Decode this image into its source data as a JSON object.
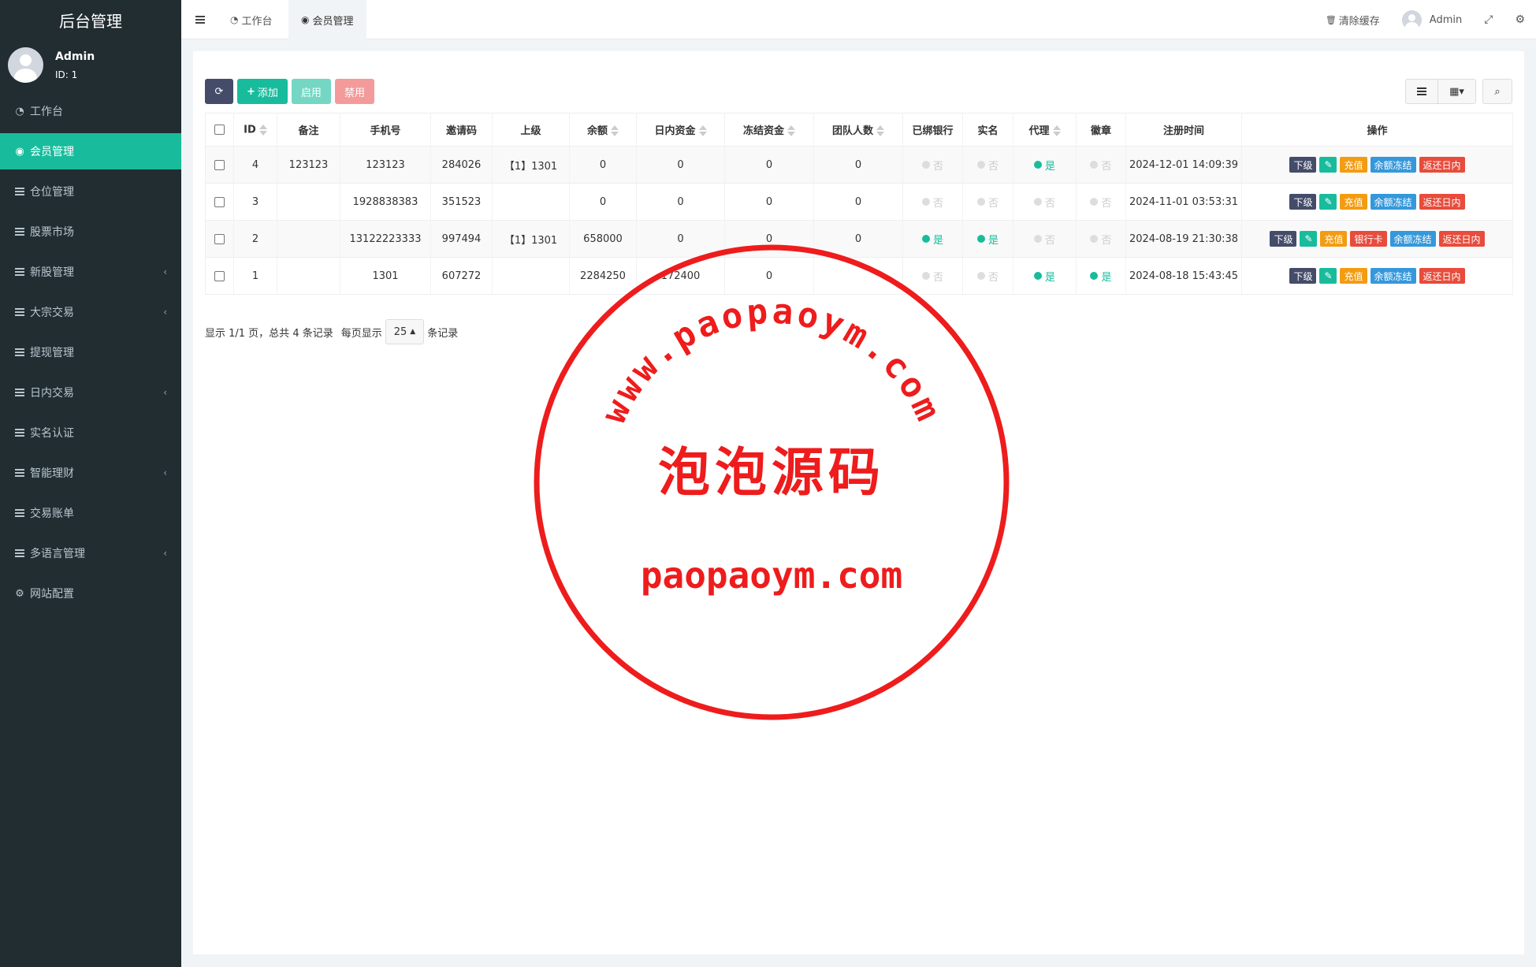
{
  "app": {
    "brand": "后台管理"
  },
  "user": {
    "name": "Admin",
    "id_text": "ID: 1"
  },
  "sidebar": {
    "items": [
      {
        "label": "工作台",
        "icon": "dashboard-icon",
        "glyph": "◔",
        "active": false,
        "expandable": false
      },
      {
        "label": "会员管理",
        "icon": "user-circle-icon",
        "glyph": "◉",
        "active": true,
        "expandable": false
      },
      {
        "label": "仓位管理",
        "icon": "list-icon",
        "glyph": "",
        "active": false,
        "expandable": false
      },
      {
        "label": "股票市场",
        "icon": "list-icon",
        "glyph": "",
        "active": false,
        "expandable": false
      },
      {
        "label": "新股管理",
        "icon": "list-icon",
        "glyph": "",
        "active": false,
        "expandable": true
      },
      {
        "label": "大宗交易",
        "icon": "list-icon",
        "glyph": "",
        "active": false,
        "expandable": true
      },
      {
        "label": "提现管理",
        "icon": "list-icon",
        "glyph": "",
        "active": false,
        "expandable": false
      },
      {
        "label": "日内交易",
        "icon": "list-icon",
        "glyph": "",
        "active": false,
        "expandable": true
      },
      {
        "label": "实名认证",
        "icon": "list-icon",
        "glyph": "",
        "active": false,
        "expandable": false
      },
      {
        "label": "智能理财",
        "icon": "list-icon",
        "glyph": "",
        "active": false,
        "expandable": true
      },
      {
        "label": "交易账单",
        "icon": "list-icon",
        "glyph": "",
        "active": false,
        "expandable": false
      },
      {
        "label": "多语言管理",
        "icon": "list-icon",
        "glyph": "",
        "active": false,
        "expandable": true
      },
      {
        "label": "网站配置",
        "icon": "gear-icon",
        "glyph": "⚙",
        "active": false,
        "expandable": false
      }
    ]
  },
  "topbar": {
    "tabs": [
      {
        "label": "工作台",
        "icon": "dashboard-icon"
      },
      {
        "label": "会员管理",
        "icon": "user-circle-icon"
      }
    ],
    "clear_cache": "清除缓存",
    "user_name": "Admin"
  },
  "toolbar": {
    "add_label": "添加",
    "enable_label": "启用",
    "disable_label": "禁用"
  },
  "table": {
    "headers": [
      "ID",
      "备注",
      "手机号",
      "邀请码",
      "上级",
      "余额",
      "日内资金",
      "冻结资金",
      "团队人数",
      "已绑银行",
      "实名",
      "代理",
      "徽章",
      "注册时间",
      "操作"
    ],
    "yes_text": "是",
    "no_text": "否",
    "rows": [
      {
        "id": "4",
        "remark": "123123",
        "phone": "123123",
        "invite": "284026",
        "parent": "【1】1301",
        "balance": "0",
        "intraday": "0",
        "frozen": "0",
        "team": "0",
        "bank": false,
        "realname": false,
        "agent": true,
        "badge": false,
        "reg_time": "2024-12-01 14:09:39",
        "ops": [
          "下级",
          "edit",
          "充值",
          "余额冻结",
          "返还日内"
        ]
      },
      {
        "id": "3",
        "remark": "",
        "phone": "1928838383",
        "invite": "351523",
        "parent": "",
        "balance": "0",
        "intraday": "0",
        "frozen": "0",
        "team": "0",
        "bank": false,
        "realname": false,
        "agent": false,
        "badge": false,
        "reg_time": "2024-11-01 03:53:31",
        "ops": [
          "下级",
          "edit",
          "充值",
          "余额冻结",
          "返还日内"
        ]
      },
      {
        "id": "2",
        "remark": "",
        "phone": "13122223333",
        "invite": "997494",
        "parent": "【1】1301",
        "balance": "658000",
        "intraday": "0",
        "frozen": "0",
        "team": "0",
        "bank": true,
        "realname": true,
        "agent": false,
        "badge": false,
        "reg_time": "2024-08-19 21:30:38",
        "ops": [
          "下级",
          "edit",
          "充值",
          "银行卡",
          "余额冻结",
          "返还日内"
        ]
      },
      {
        "id": "1",
        "remark": "",
        "phone": "1301",
        "invite": "607272",
        "parent": "",
        "balance": "2284250",
        "intraday": "172400",
        "frozen": "0",
        "team": "",
        "bank": false,
        "realname": false,
        "agent": true,
        "badge": true,
        "reg_time": "2024-08-18 15:43:45",
        "ops": [
          "下级",
          "edit",
          "充值",
          "余额冻结",
          "返还日内"
        ]
      }
    ]
  },
  "pager": {
    "summary": "显示 1/1 页，总共 4 条记录",
    "per_page_label": "每页显示",
    "per_page_value": "25",
    "suffix": "条记录"
  },
  "watermark": {
    "arc_text": "www.paopaoym.com",
    "center_text": "泡泡源码",
    "bottom_text": "paopaoym.com",
    "color": "#ee1c1c"
  },
  "colors": {
    "accent": "#18bc9c",
    "sidebar_bg": "#222d32",
    "danger": "#e74c3c",
    "warning": "#f39c12",
    "info": "#3498db",
    "dark": "#444c69"
  }
}
